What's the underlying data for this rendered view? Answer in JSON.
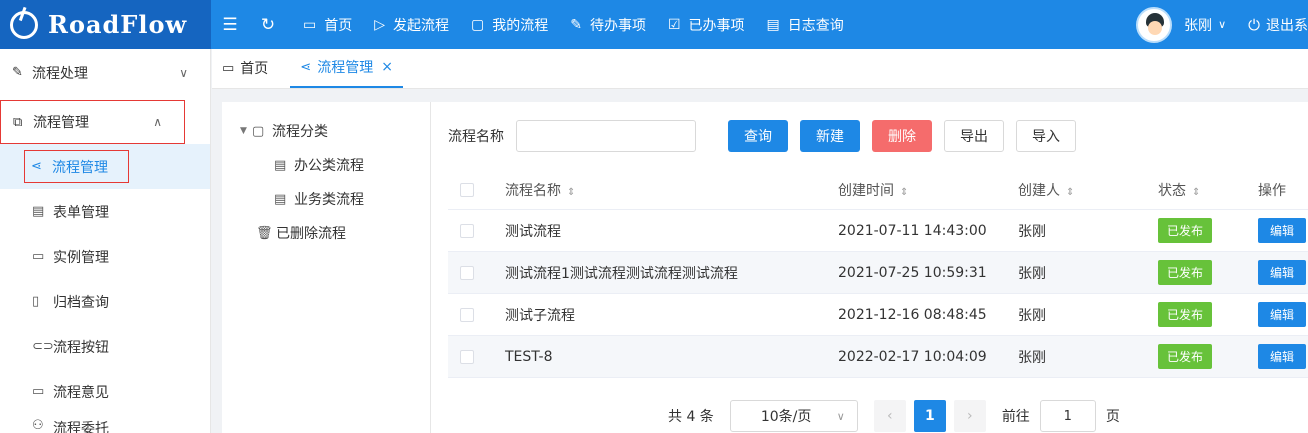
{
  "app": {
    "logo_text": "RoadFlow"
  },
  "topnav": {
    "items": [
      {
        "label": "首页",
        "icon": "monitor-icon"
      },
      {
        "label": "发起流程",
        "icon": "play-circle-icon"
      },
      {
        "label": "我的流程",
        "icon": "folder-icon"
      },
      {
        "label": "待办事项",
        "icon": "edit-icon"
      },
      {
        "label": "已办事项",
        "icon": "check-folder-icon"
      },
      {
        "label": "日志查询",
        "icon": "calendar-icon"
      }
    ],
    "user_name": "张刚",
    "logout_label": "退出系"
  },
  "sidebar": {
    "groups": [
      {
        "label": "流程处理"
      },
      {
        "label": "流程管理"
      }
    ],
    "items": [
      {
        "label": "流程管理"
      },
      {
        "label": "表单管理"
      },
      {
        "label": "实例管理"
      },
      {
        "label": "归档查询"
      },
      {
        "label": "流程按钮"
      },
      {
        "label": "流程意见"
      },
      {
        "label": "流程委托"
      }
    ]
  },
  "tabs": [
    {
      "label": "首页"
    },
    {
      "label": "流程管理",
      "close": "×"
    }
  ],
  "tree": {
    "root": "流程分类",
    "children": [
      "办公类流程",
      "业务类流程"
    ],
    "deleted": "已删除流程"
  },
  "search": {
    "label": "流程名称",
    "value": "",
    "buttons": {
      "query": "查询",
      "create": "新建",
      "delete": "删除",
      "export": "导出",
      "import": "导入"
    }
  },
  "table": {
    "headers": {
      "name": "流程名称",
      "time": "创建时间",
      "creator": "创建人",
      "status": "状态",
      "op": "操作"
    },
    "rows": [
      {
        "name": "测试流程",
        "time": "2021-07-11 14:43:00",
        "creator": "张刚",
        "status": "已发布",
        "op": "编辑"
      },
      {
        "name": "测试流程1测试流程测试流程测试流程",
        "time": "2021-07-25 10:59:31",
        "creator": "张刚",
        "status": "已发布",
        "op": "编辑"
      },
      {
        "name": "测试子流程",
        "time": "2021-12-16 08:48:45",
        "creator": "张刚",
        "status": "已发布",
        "op": "编辑"
      },
      {
        "name": "TEST-8",
        "time": "2022-02-17 10:04:09",
        "creator": "张刚",
        "status": "已发布",
        "op": "编辑"
      }
    ]
  },
  "pagination": {
    "total": "共 4 条",
    "page_size": "10条/页",
    "current_page": "1",
    "goto_label": "前往",
    "goto_value": "1",
    "page_suffix": "页"
  },
  "colors": {
    "primary": "#1e88e5",
    "danger": "#f56c6c",
    "success": "#67c23a",
    "highlight_border": "#e53935"
  }
}
